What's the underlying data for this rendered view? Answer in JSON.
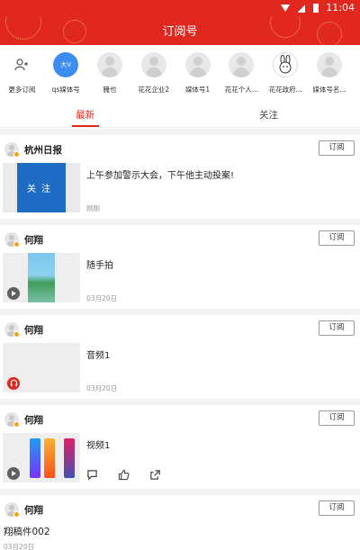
{
  "status_bar": {
    "time": "11:04"
  },
  "header": {
    "title": "订阅号"
  },
  "channels": [
    {
      "label": "更多订阅",
      "kind": "add"
    },
    {
      "label": "qs媒体号",
      "kind": "blue",
      "avatar_text": "大V"
    },
    {
      "label": "腌也",
      "kind": "person"
    },
    {
      "label": "花花企业2",
      "kind": "person"
    },
    {
      "label": "媒体号1",
      "kind": "person"
    },
    {
      "label": "花花个人...",
      "kind": "person"
    },
    {
      "label": "花花政府...",
      "kind": "emoji"
    },
    {
      "label": "媒体号名...",
      "kind": "person"
    }
  ],
  "tabs": {
    "latest": "最新",
    "following": "关注"
  },
  "subscribe_label": "订阅",
  "feed": [
    {
      "author": "杭州日报",
      "title": "上午参加警示大会，下午他主动投案!",
      "date": "刚刚",
      "thumb_text": "关注",
      "media": "image"
    },
    {
      "author": "何翔",
      "title": "随手拍",
      "date": "03月20日",
      "media": "video"
    },
    {
      "author": "何翔",
      "title": "音频1",
      "date": "03月20日",
      "media": "audio"
    },
    {
      "author": "何翔",
      "title": "视频1",
      "media": "video"
    },
    {
      "author": "何翔",
      "title": "翔稿件002",
      "date": "03月20日",
      "media": "text"
    }
  ],
  "colors": {
    "brand_red": "#e0281e",
    "badge_orange": "#f3a71d"
  }
}
